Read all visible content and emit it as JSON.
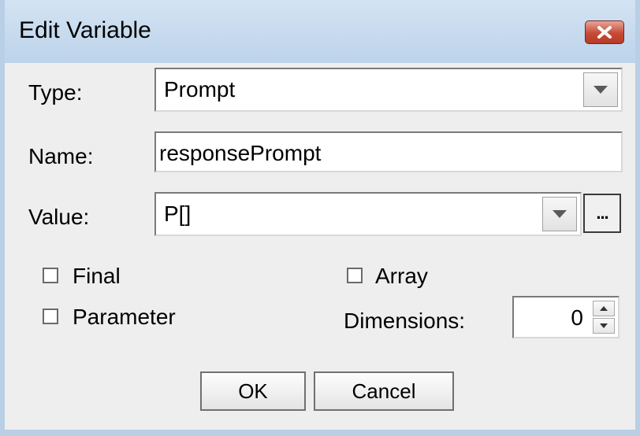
{
  "window": {
    "title": "Edit Variable",
    "close_symbol": "close-icon"
  },
  "form": {
    "type_label": "Type:",
    "type_value": "Prompt",
    "name_label": "Name:",
    "name_value": "responsePrompt",
    "value_label": "Value:",
    "value_value": "P[]",
    "browse_label": "...",
    "final_label": "Final",
    "final_checked": false,
    "array_label": "Array",
    "array_checked": false,
    "parameter_label": "Parameter",
    "parameter_checked": false,
    "dimensions_label": "Dimensions:",
    "dimensions_value": "0"
  },
  "buttons": {
    "ok_label": "OK",
    "cancel_label": "Cancel"
  },
  "colors": {
    "title_bar": "#c9dcef",
    "close_button": "#c64a36",
    "dialog_background": "#eeeeee"
  }
}
